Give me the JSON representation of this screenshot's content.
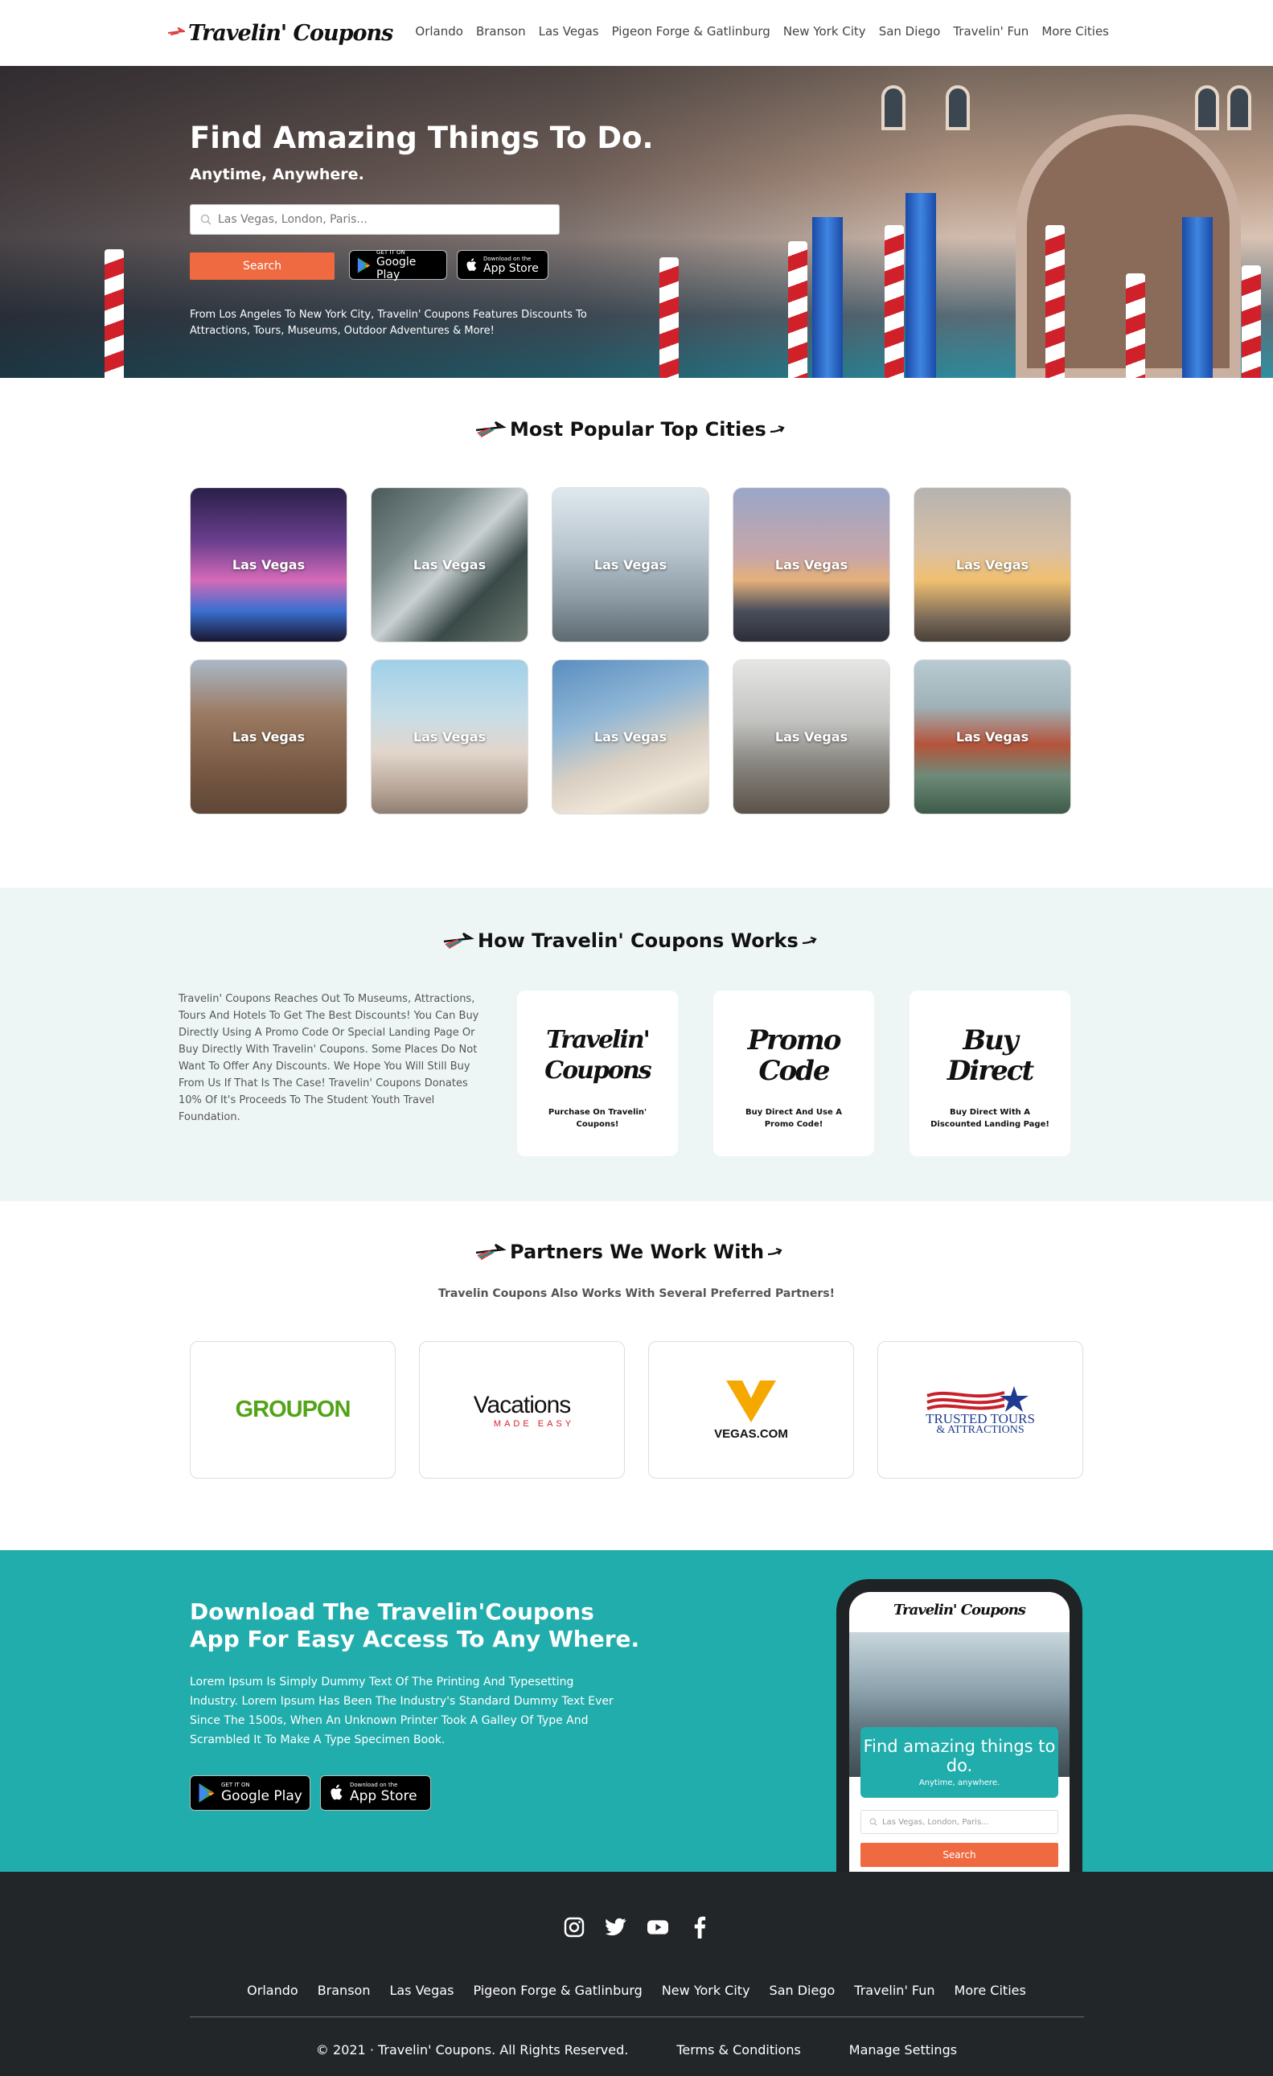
{
  "brand": {
    "name": "Travelin' Coupons"
  },
  "nav": {
    "links": [
      "Orlando",
      "Branson",
      "Las Vegas",
      "Pigeon Forge & Gatlinburg",
      "New York City",
      "San Diego",
      "Travelin' Fun",
      "More Cities"
    ]
  },
  "hero": {
    "title": "Find Amazing Things To Do.",
    "subtitle": "Anytime, Anywhere.",
    "search_placeholder": "Las Vegas, London, Paris...",
    "search_button": "Search",
    "google_play_small": "GET IT ON",
    "google_play_big": "Google Play",
    "app_store_small": "Download on the",
    "app_store_big": "App Store",
    "description": "From Los Angeles To New York City, Travelin' Coupons Features Discounts To Attractions, Tours, Museums, Outdoor Adventures & More!"
  },
  "popular": {
    "title": "Most Popular Top Cities",
    "cities": [
      "Las Vegas",
      "Las Vegas",
      "Las Vegas",
      "Las Vegas",
      "Las Vegas",
      "Las Vegas",
      "Las Vegas",
      "Las Vegas",
      "Las Vegas",
      "Las Vegas"
    ]
  },
  "how": {
    "title": "How Travelin' Coupons Works",
    "text": "Travelin' Coupons Reaches Out To Museums, Attractions, Tours And Hotels To Get The Best Discounts! You Can Buy Directly Using A Promo Code Or Special Landing Page Or Buy Directly With Travelin' Coupons. Some Places Do Not Want To Offer Any Discounts. We Hope You Will Still Buy From Us If That Is The Case! Travelin' Coupons Donates 10% Of It's Proceeds To The Student Youth Travel Foundation.",
    "cards": [
      {
        "script": "Travelin' Coupons",
        "caption": "Purchase On Travelin' Coupons!"
      },
      {
        "script": "Promo Code",
        "caption": "Buy Direct And Use A Promo Code!"
      },
      {
        "script": "Buy Direct",
        "caption": "Buy Direct With A Discounted Landing Page!"
      }
    ]
  },
  "partners": {
    "title": "Partners We Work With",
    "subtitle": "Travelin Coupons Also Works With Several Preferred Partners!",
    "logos": [
      "GROUPON",
      "Vacations",
      "MADE EASY",
      "VEGAS.COM",
      "TRUSTED TOURS",
      "& ATTRACTIONS"
    ]
  },
  "download": {
    "title": "Download The Travelin'Coupons App For Easy Access To Any Where.",
    "text": "Lorem Ipsum Is Simply Dummy Text Of The Printing And Typesetting Industry. Lorem Ipsum Has Been The Industry's Standard Dummy Text Ever Since The 1500s, When An Unknown Printer Took A Galley Of Type And Scrambled It To Make A Type Specimen Book.",
    "phone": {
      "logo": "Travelin' Coupons",
      "title": "Find amazing things to do.",
      "subtitle": "Anytime, anywhere.",
      "placeholder": "Las Vegas, London, Paris...",
      "button": "Search"
    }
  },
  "footer": {
    "social_icons": [
      "instagram-icon",
      "twitter-icon",
      "youtube-icon",
      "facebook-icon"
    ],
    "links": [
      "Orlando",
      "Branson",
      "Las Vegas",
      "Pigeon Forge & Gatlinburg",
      "New York City",
      "San Diego",
      "Travelin' Fun",
      "More Cities"
    ],
    "copyright": "© 2021 · Travelin' Coupons. All Rights Reserved.",
    "terms": "Terms & Conditions",
    "manage": "Manage Settings"
  },
  "colors": {
    "accent_orange": "#ef6a40",
    "teal": "#22adad",
    "footer_bg": "#232629",
    "how_bg": "#eef6f5"
  }
}
